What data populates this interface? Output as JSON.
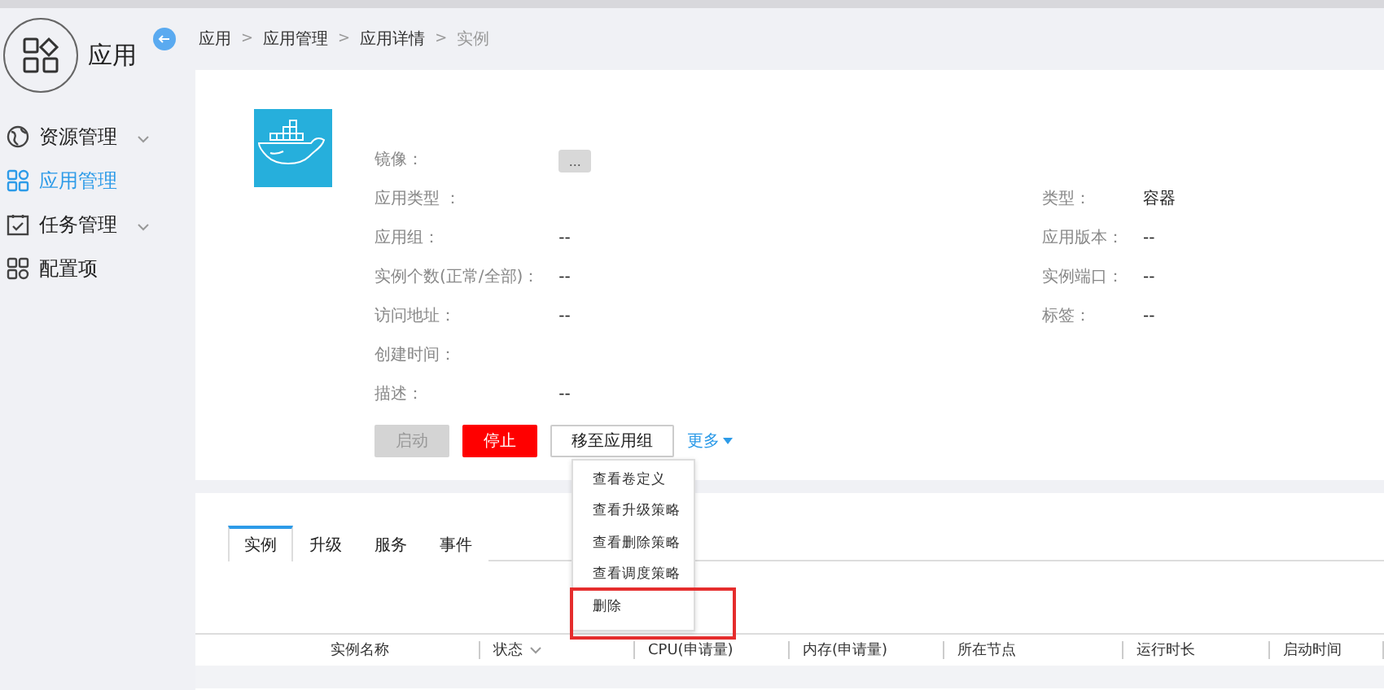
{
  "sidebar": {
    "logo_text": "应用",
    "items": [
      {
        "label": "资源管理",
        "selected": false,
        "expandable": true
      },
      {
        "label": "应用管理",
        "selected": true,
        "expandable": false
      },
      {
        "label": "任务管理",
        "selected": false,
        "expandable": true
      },
      {
        "label": "配置项",
        "selected": false,
        "expandable": false
      }
    ]
  },
  "breadcrumb": {
    "separator": ">",
    "items": [
      "应用",
      "应用管理",
      "应用详情",
      "实例"
    ]
  },
  "detail": {
    "left_fields": [
      {
        "label": "镜像：",
        "kind": "button",
        "value": "..."
      },
      {
        "label": "应用类型 ：",
        "kind": "text"
      },
      {
        "label": "应用组：",
        "kind": "text",
        "value": "--"
      },
      {
        "label": "实例个数(正常/全部)：",
        "kind": "text",
        "value": "--"
      },
      {
        "label": "访问地址：",
        "kind": "text",
        "value": "--"
      },
      {
        "label": "创建时间：",
        "kind": "text"
      },
      {
        "label": "描述：",
        "kind": "text",
        "value": "--"
      }
    ],
    "right_fields": [
      {
        "label": "类型：",
        "value": "容器"
      },
      {
        "label": "应用版本：",
        "value": "--"
      },
      {
        "label": "实例端口：",
        "value": "--"
      },
      {
        "label": "标签：",
        "value": "--"
      }
    ],
    "actions": [
      {
        "label": "启动",
        "kind": "start",
        "disabled": true
      },
      {
        "label": "停止",
        "kind": "stop",
        "disabled": false
      },
      {
        "label": "移至应用组",
        "kind": "plain",
        "disabled": false
      }
    ],
    "more": {
      "label": "更多",
      "expanded": true,
      "items": [
        "查看卷定义",
        "查看升级策略",
        "查看删除策略",
        "查看调度策略",
        "删除"
      ]
    }
  },
  "tabs": [
    {
      "label": "实例",
      "selected": true
    },
    {
      "label": "升级",
      "selected": false
    },
    {
      "label": "服务",
      "selected": false
    },
    {
      "label": "事件",
      "selected": false
    }
  ],
  "table": {
    "columns": [
      {
        "label": "实例名称",
        "sortable": false
      },
      {
        "label": "状态",
        "sortable": true
      },
      {
        "label": "CPU(申请量)",
        "sortable": false
      },
      {
        "label": "内存(申请量)",
        "sortable": false
      },
      {
        "label": "所在节点",
        "sortable": false
      },
      {
        "label": "运行时长",
        "sortable": false
      },
      {
        "label": "启动时间",
        "sortable": false
      }
    ]
  }
}
